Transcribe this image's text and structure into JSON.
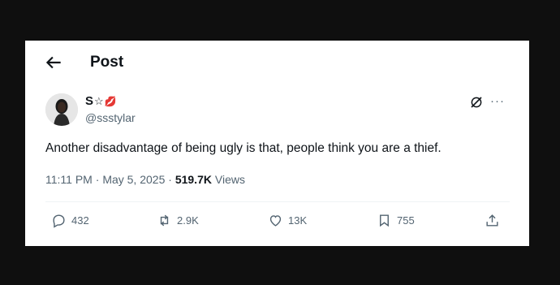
{
  "header": {
    "title": "Post",
    "back_icon": "arrow-left-icon"
  },
  "author": {
    "name": "S",
    "name_emoji_1": "☆",
    "name_emoji_2": "💋",
    "handle": "@ssstylar"
  },
  "post": {
    "text": "Another disadvantage of being ugly is that, people think you are a thief.",
    "time": "11:11 PM",
    "separator": "·",
    "date": "May 5, 2025",
    "views_count": "519.7K",
    "views_label": "Views"
  },
  "actions": {
    "replies": "432",
    "reposts": "2.9K",
    "likes": "13K",
    "bookmarks": "755"
  },
  "icons": {
    "grok": "grok-icon",
    "more": "more-icon",
    "reply": "reply-icon",
    "repost": "repost-icon",
    "like": "heart-icon",
    "bookmark": "bookmark-icon",
    "share": "share-icon"
  },
  "colors": {
    "text": "#0f1419",
    "secondary": "#536471",
    "background": "#ffffff",
    "frame": "#0f0f0f"
  }
}
